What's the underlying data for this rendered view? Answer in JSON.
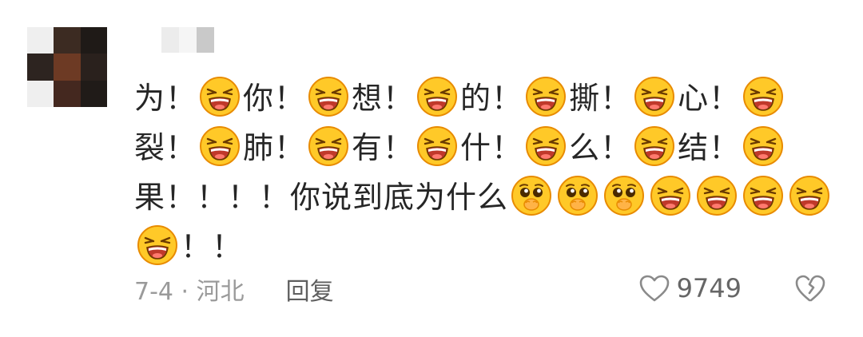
{
  "comment": {
    "avatar_pixels": [
      "#efefef",
      "#3c2b22",
      "#1f1a17",
      "#2d2420",
      "#6d3a24",
      "#2a211d",
      "#efefef",
      "#44281f",
      "#201b18"
    ],
    "username_pixels": [
      "#ececec",
      "#f5f5f5",
      "#c9c9c9"
    ],
    "content": [
      {
        "type": "text",
        "value": "为！"
      },
      {
        "type": "emoji",
        "name": "grimace-emoji"
      },
      {
        "type": "text",
        "value": "你！"
      },
      {
        "type": "emoji",
        "name": "grimace-emoji"
      },
      {
        "type": "text",
        "value": "想！"
      },
      {
        "type": "emoji",
        "name": "grimace-emoji"
      },
      {
        "type": "text",
        "value": "的！"
      },
      {
        "type": "emoji",
        "name": "grimace-emoji"
      },
      {
        "type": "text",
        "value": "撕！"
      },
      {
        "type": "emoji",
        "name": "grimace-emoji"
      },
      {
        "type": "text",
        "value": "心！"
      },
      {
        "type": "emoji",
        "name": "grimace-emoji"
      },
      {
        "type": "text",
        "value": "裂！"
      },
      {
        "type": "emoji",
        "name": "grimace-emoji"
      },
      {
        "type": "text",
        "value": "肺！"
      },
      {
        "type": "emoji",
        "name": "grimace-emoji"
      },
      {
        "type": "text",
        "value": "有！"
      },
      {
        "type": "emoji",
        "name": "grimace-emoji"
      },
      {
        "type": "text",
        "value": "什！"
      },
      {
        "type": "emoji",
        "name": "grimace-emoji"
      },
      {
        "type": "text",
        "value": "么！"
      },
      {
        "type": "emoji",
        "name": "grimace-emoji"
      },
      {
        "type": "text",
        "value": "结！"
      },
      {
        "type": "emoji",
        "name": "grimace-emoji"
      },
      {
        "type": "text",
        "value": "果！！！！你说到底为什么"
      },
      {
        "type": "emoji",
        "name": "pleading-emoji"
      },
      {
        "type": "emoji",
        "name": "pleading-emoji"
      },
      {
        "type": "emoji",
        "name": "pleading-emoji"
      },
      {
        "type": "emoji",
        "name": "grimace-emoji"
      },
      {
        "type": "emoji",
        "name": "grimace-emoji"
      },
      {
        "type": "emoji",
        "name": "grimace-emoji"
      },
      {
        "type": "emoji",
        "name": "grimace-emoji"
      },
      {
        "type": "emoji",
        "name": "grimace-emoji"
      },
      {
        "type": "text",
        "value": "！！"
      }
    ],
    "date_location": "7-4 · 河北",
    "reply_label": "回复",
    "like_count": "9749",
    "icons": {
      "like": "heart-outline-icon",
      "dislike": "broken-heart-icon"
    },
    "colors": {
      "text": "#262626",
      "meta": "#9a9a9a",
      "reply": "#5f5f5f",
      "emoji_face": "#ffc928",
      "emoji_outline": "#e88b00"
    }
  }
}
